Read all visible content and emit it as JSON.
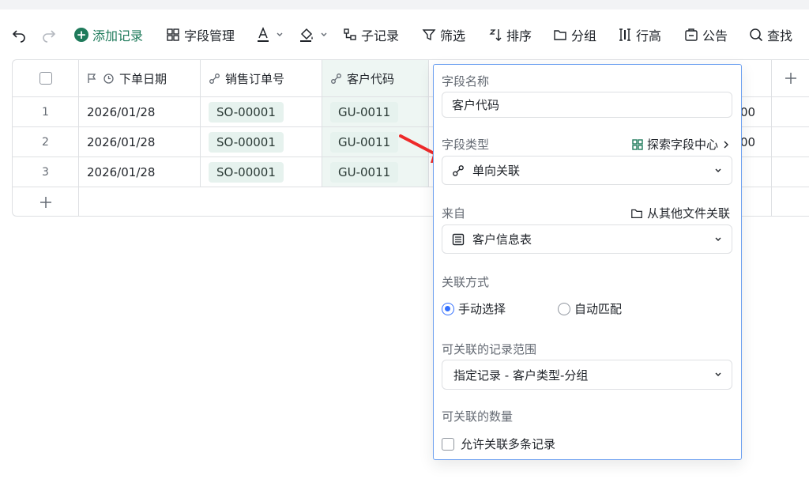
{
  "toolbar": {
    "add_record": "添加记录",
    "field_manage": "字段管理",
    "sub_record": "子记录",
    "filter": "筛选",
    "sort": "排序",
    "group": "分组",
    "row_height": "行高",
    "announcement": "公告",
    "search": "查找"
  },
  "table": {
    "columns": [
      {
        "label": "下单日期",
        "icon": "date-icon"
      },
      {
        "label": "销售订单号",
        "icon": "link-icon"
      },
      {
        "label": "客户代码",
        "icon": "link-icon"
      }
    ],
    "rows": [
      {
        "index": "1",
        "date": "2026/01/28",
        "order": "SO-00001",
        "customer": "GU-0011",
        "tail": "00"
      },
      {
        "index": "2",
        "date": "2026/01/28",
        "order": "SO-00001",
        "customer": "GU-0011",
        "tail": "00"
      },
      {
        "index": "3",
        "date": "2026/01/28",
        "order": "SO-00001",
        "customer": "GU-0011",
        "tail": ""
      }
    ]
  },
  "panel": {
    "field_name_label": "字段名称",
    "field_name_value": "客户代码",
    "field_type_label": "字段类型",
    "explore_link": "探索字段中心",
    "field_type_value": "单向关联",
    "source_label": "来自",
    "other_file_link": "从其他文件关联",
    "source_value": "客户信息表",
    "link_mode_label": "关联方式",
    "mode_manual": "手动选择",
    "mode_auto": "自动匹配",
    "range_label": "可关联的记录范围",
    "range_value": "指定记录 - 客户类型-分组",
    "count_label": "可关联的数量",
    "allow_multiple": "允许关联多条记录"
  },
  "colors": {
    "accent_green": "#1f7a5b",
    "chip_bg": "#e6f2ee",
    "panel_border": "#6ea1f0",
    "radio_blue": "#3370ff",
    "arrow_red": "#ee2a2a"
  }
}
